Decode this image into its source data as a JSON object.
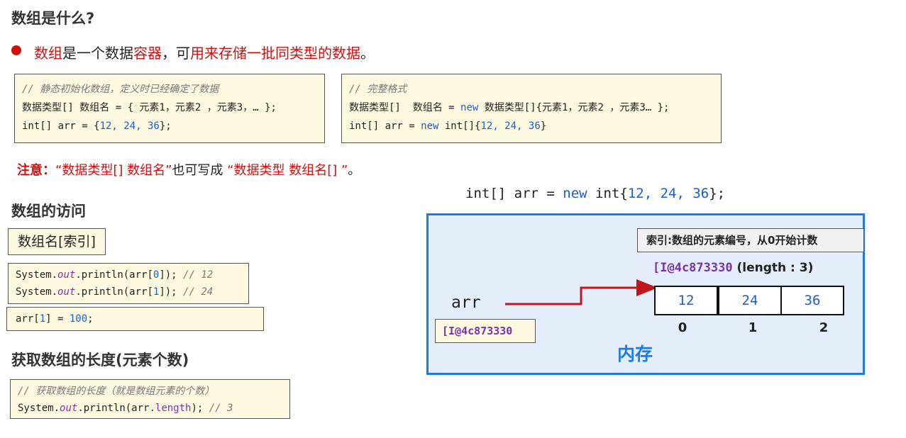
{
  "title": "数组是什么?",
  "definition": {
    "part1": "数组",
    "part2": "是一个数据",
    "part3": "容器",
    "part4": "，可",
    "part5": "用来存储一批同类型的数据",
    "part6": "。"
  },
  "static_init": {
    "comment": "// 静态初始化数组，定义时已经确定了数据",
    "syntax": "数据类型[] 数组名 = { 元素1，元素2 ，元素3，… };",
    "example_prefix": "int[] arr = {",
    "example_values": "12, 24, 36",
    "example_suffix": "};"
  },
  "full_format": {
    "comment": "// 完整格式",
    "syntax_prefix": "数据类型[]  数组名 = ",
    "syntax_new": "new",
    "syntax_suffix": " 数据类型[]{元素1，元素2 ，元素3… };",
    "example_prefix": "int[] arr = ",
    "example_new": "new",
    "example_type": " int[]{",
    "example_values": "12, 24, 36",
    "example_suffix": "}"
  },
  "note": {
    "label": "注意：",
    "q1": "“数据类型[] 数组名”",
    "mid": "也可写成 ",
    "q2": "“数据类型 数组名[] ”",
    "end": "。"
  },
  "access": {
    "heading": "数组的访问",
    "syntax": "数组名[索引]",
    "line1_prefix": "System.",
    "line1_field": "out",
    "line1_mid": ".println(arr[",
    "line1_idx": "0",
    "line1_end": "]); ",
    "line1_comment": "// 12",
    "line2_prefix": "System.",
    "line2_field": "out",
    "line2_mid": ".println(arr[",
    "line2_idx": "1",
    "line2_end": "]); ",
    "line2_comment": "// 24",
    "assign_prefix": "arr[",
    "assign_idx": "1",
    "assign_mid": "] = ",
    "assign_val": "100",
    "assign_end": ";"
  },
  "length": {
    "heading": "获取数组的长度(元素个数)",
    "comment": "// 获取数组的长度（就是数组元素的个数）",
    "line_prefix": "System.",
    "line_field": "out",
    "line_mid": ".println(arr.",
    "line_length": "length",
    "line_end": "); ",
    "line_comment": "// 3"
  },
  "diagram": {
    "code_prefix": "int[] arr = ",
    "code_new": "new",
    "code_type": " int{",
    "code_values": "12, 24, 36",
    "code_suffix": "};",
    "index_note": "索引:数组的元素编号，从0开始计数",
    "address_header": "[I@4c873330",
    "length_label": "(length : 3)",
    "var_name": "arr",
    "var_address": "[I@4c873330",
    "cells": [
      "12",
      "24",
      "36"
    ],
    "indices": [
      "0",
      "1",
      "2"
    ],
    "memory_label": "内存",
    "border_color": "#1e7be6",
    "fill_color": "#e3eefa",
    "arrow_color": "#c0151a"
  }
}
